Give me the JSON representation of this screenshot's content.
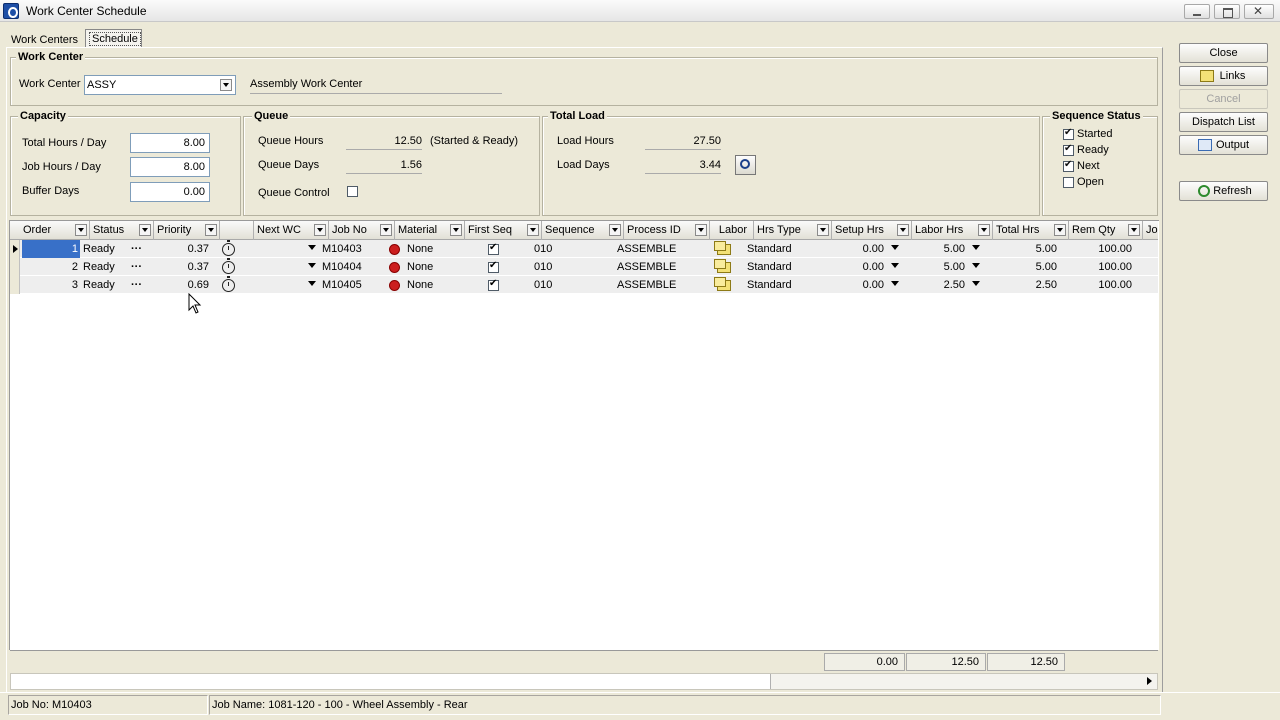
{
  "window": {
    "title": "Work Center Schedule"
  },
  "tabs": [
    {
      "label": "Work Centers"
    },
    {
      "label": "Schedule"
    }
  ],
  "work_center": {
    "group_title": "Work Center",
    "label": "Work Center",
    "code": "ASSY",
    "description": "Assembly Work Center"
  },
  "capacity": {
    "title": "Capacity",
    "total_hours_label": "Total Hours / Day",
    "total_hours": "8.00",
    "job_hours_label": "Job Hours / Day",
    "job_hours": "8.00",
    "buffer_days_label": "Buffer Days",
    "buffer_days": "0.00"
  },
  "queue": {
    "title": "Queue",
    "hours_label": "Queue Hours",
    "hours": "12.50",
    "hours_note": "(Started & Ready)",
    "days_label": "Queue Days",
    "days": "1.56",
    "control_label": "Queue Control",
    "control_checked": false
  },
  "total_load": {
    "title": "Total Load",
    "hours_label": "Load Hours",
    "hours": "27.50",
    "days_label": "Load Days",
    "days": "3.44"
  },
  "sequence_status": {
    "title": "Sequence Status",
    "items": [
      {
        "label": "Started",
        "checked": true
      },
      {
        "label": "Ready",
        "checked": true
      },
      {
        "label": "Next",
        "checked": true
      },
      {
        "label": "Open",
        "checked": false
      }
    ]
  },
  "side_buttons": {
    "close": "Close",
    "links": "Links",
    "cancel": "Cancel",
    "dispatch": "Dispatch List",
    "output": "Output",
    "refresh": "Refresh"
  },
  "grid": {
    "columns": [
      "Order",
      "Status",
      "Priority",
      "",
      "Next WC",
      "Job No",
      "Material",
      "First Seq",
      "Sequence",
      "Process ID",
      "Labor",
      "Hrs Type",
      "Setup Hrs",
      "Labor Hrs",
      "Total Hrs",
      "Rem Qty",
      "Job"
    ],
    "rows": [
      {
        "order": "1",
        "status": "Ready",
        "priority": "0.37",
        "next_wc": "",
        "job_no": "M10403",
        "material": "None",
        "first_seq": true,
        "sequence": "010",
        "process_id": "ASSEMBLE",
        "hrs_type": "Standard",
        "setup_hrs": "0.00",
        "labor_hrs": "5.00",
        "total_hrs": "5.00",
        "rem_qty": "100.00"
      },
      {
        "order": "2",
        "status": "Ready",
        "priority": "0.37",
        "next_wc": "",
        "job_no": "M10404",
        "material": "None",
        "first_seq": true,
        "sequence": "010",
        "process_id": "ASSEMBLE",
        "hrs_type": "Standard",
        "setup_hrs": "0.00",
        "labor_hrs": "5.00",
        "total_hrs": "5.00",
        "rem_qty": "100.00"
      },
      {
        "order": "3",
        "status": "Ready",
        "priority": "0.69",
        "next_wc": "",
        "job_no": "M10405",
        "material": "None",
        "first_seq": true,
        "sequence": "010",
        "process_id": "ASSEMBLE",
        "hrs_type": "Standard",
        "setup_hrs": "0.00",
        "labor_hrs": "2.50",
        "total_hrs": "2.50",
        "rem_qty": "100.00"
      }
    ],
    "totals": {
      "setup": "0.00",
      "labor": "12.50",
      "total": "12.50"
    }
  },
  "status_bar": {
    "job_no": "Job No: M10403",
    "job_name": "Job Name: 1081-120 - 100 - Wheel Assembly - Rear"
  }
}
